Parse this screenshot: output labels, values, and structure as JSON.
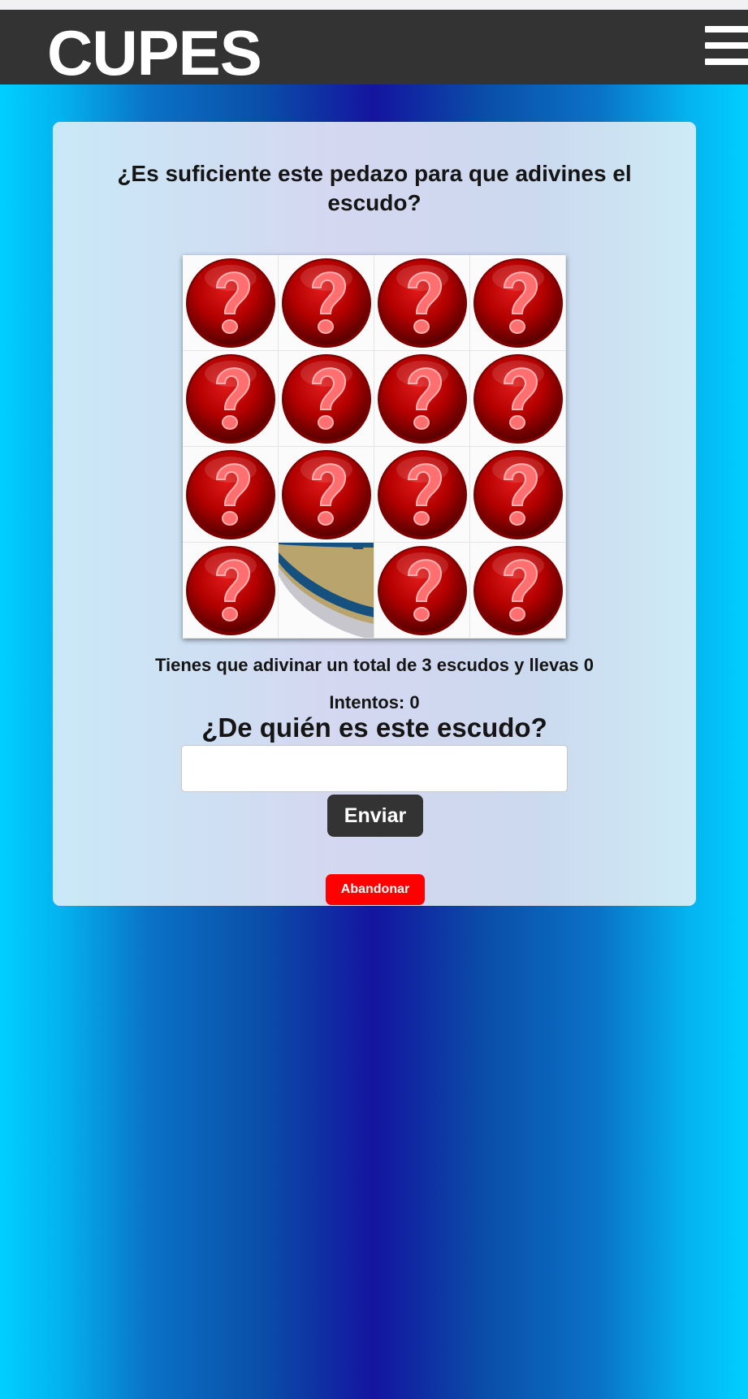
{
  "header": {
    "brand": "CUPES",
    "menu_icon": "hamburger-menu-icon"
  },
  "game": {
    "question": "¿Es suficiente este pedazo para que adivines el escudo?",
    "tiles": [
      {
        "state": "hidden",
        "icon": "question-mark-icon"
      },
      {
        "state": "hidden",
        "icon": "question-mark-icon"
      },
      {
        "state": "hidden",
        "icon": "question-mark-icon"
      },
      {
        "state": "hidden",
        "icon": "question-mark-icon"
      },
      {
        "state": "hidden",
        "icon": "question-mark-icon"
      },
      {
        "state": "hidden",
        "icon": "question-mark-icon"
      },
      {
        "state": "hidden",
        "icon": "question-mark-icon"
      },
      {
        "state": "hidden",
        "icon": "question-mark-icon"
      },
      {
        "state": "hidden",
        "icon": "question-mark-icon"
      },
      {
        "state": "hidden",
        "icon": "question-mark-icon"
      },
      {
        "state": "hidden",
        "icon": "question-mark-icon"
      },
      {
        "state": "hidden",
        "icon": "question-mark-icon"
      },
      {
        "state": "hidden",
        "icon": "question-mark-icon"
      },
      {
        "state": "revealed",
        "icon": "crest-fragment-image"
      },
      {
        "state": "hidden",
        "icon": "question-mark-icon"
      },
      {
        "state": "hidden",
        "icon": "question-mark-icon"
      }
    ],
    "total_text": "Tienes que adivinar un total de 3 escudos y llevas 0",
    "attempts_text": "Intentos: 0",
    "prompt": "¿De quién es este escudo?",
    "answer_value": "",
    "send_label": "Enviar",
    "quit_label": "Abandonar"
  },
  "colors": {
    "navbar": "#333333",
    "quit_button": "#ff0000",
    "question_ball": "#a80000"
  }
}
